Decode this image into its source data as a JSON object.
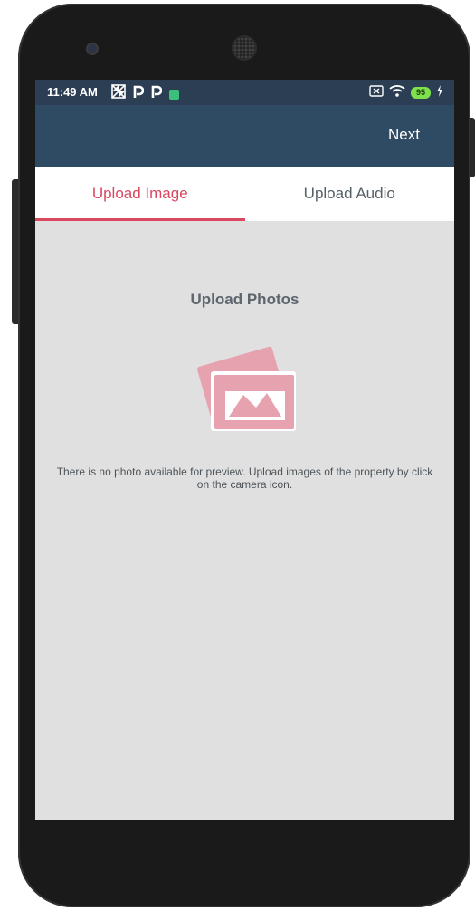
{
  "status_bar": {
    "time": "11:49 AM",
    "battery_level": "95",
    "icons_left": [
      "pinwheel-icon",
      "p-icon",
      "p-icon",
      "green-app-icon"
    ],
    "icons_right": [
      "no-sim-icon",
      "wifi-icon",
      "battery-icon",
      "charging-icon"
    ]
  },
  "app_bar": {
    "next_label": "Next"
  },
  "tabs": [
    {
      "label": "Upload Image",
      "active": true
    },
    {
      "label": "Upload Audio",
      "active": false
    }
  ],
  "content": {
    "title": "Upload Photos",
    "empty_message": "There is no photo available for preview. Upload images of the property by click on the camera icon.",
    "icon": "photos-icon"
  },
  "fab": {
    "label": "+",
    "icon": "add-icon"
  },
  "colors": {
    "accent": "#d9485f",
    "app_bar": "#2f4a63",
    "status_bar": "#2b3e53",
    "background": "#e0e0e0",
    "illustration": "#e6a2ae"
  }
}
